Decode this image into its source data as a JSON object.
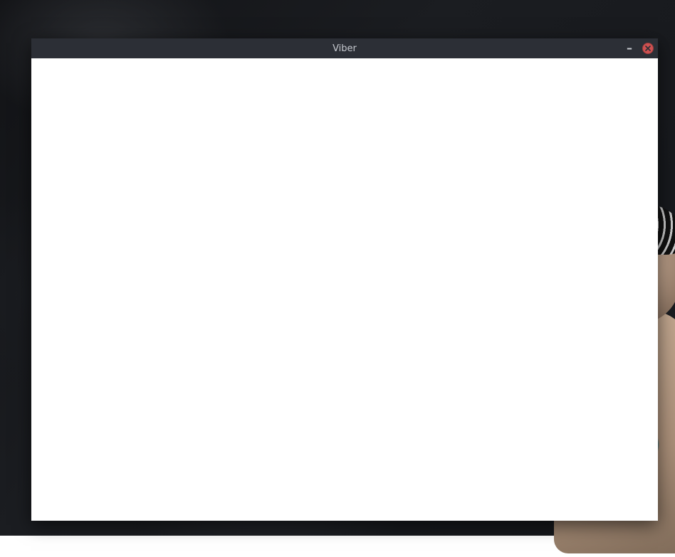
{
  "window": {
    "title": "Viber",
    "minimize_glyph": "–"
  }
}
